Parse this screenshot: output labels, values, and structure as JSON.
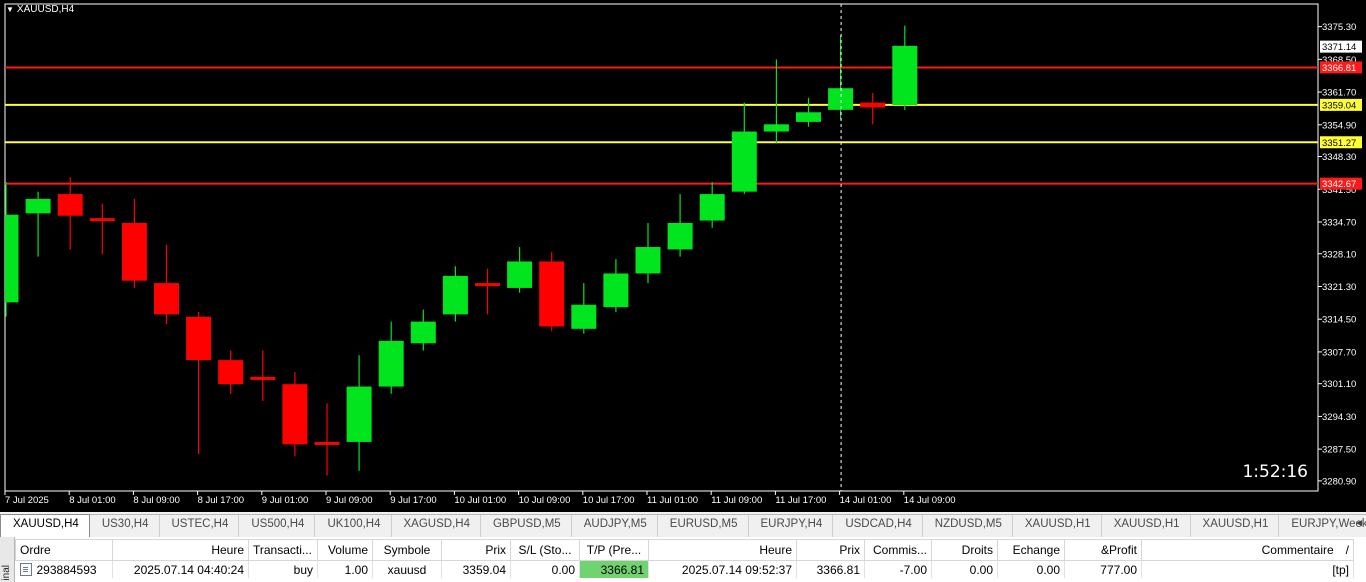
{
  "chart": {
    "symbol_title": "XAUUSD,H4",
    "countdown": "1:52:16",
    "colors": {
      "background": "#000000",
      "bull": "#00e51e",
      "bear": "#ff0000",
      "red_line": "#ff1a1a",
      "yellow_line": "#ffff33",
      "axis_text": "#ffffff"
    }
  },
  "chart_data": {
    "type": "candlestick",
    "title": "XAUUSD,H4",
    "ylim": [
      3278.8,
      3380.0
    ],
    "y_ticks": [
      3375.3,
      3368.5,
      3361.7,
      3354.9,
      3348.3,
      3341.5,
      3334.7,
      3328.1,
      3321.3,
      3314.5,
      3307.7,
      3301.1,
      3294.3,
      3287.5,
      3280.9
    ],
    "y_tick_labels": [
      "3375.30",
      "3368.50",
      "3361.70",
      "3354.90",
      "3348.30",
      "3341.50",
      "3334.70",
      "3328.10",
      "3321.30",
      "3314.50",
      "3307.70",
      "3301.10",
      "3294.30",
      "3287.50",
      "3280.90"
    ],
    "x_tick_labels": [
      "7 Jul 2025",
      "8 Jul 01:00",
      "8 Jul 09:00",
      "8 Jul 17:00",
      "9 Jul 01:00",
      "9 Jul 09:00",
      "9 Jul 17:00",
      "10 Jul 01:00",
      "10 Jul 09:00",
      "10 Jul 17:00",
      "11 Jul 01:00",
      "11 Jul 09:00",
      "11 Jul 17:00",
      "14 Jul 01:00",
      "14 Jul 09:00"
    ],
    "candles": [
      {
        "o": 3318.0,
        "h": 3343.0,
        "l": 3315.0,
        "c": 3336.2
      },
      {
        "o": 3336.5,
        "h": 3341.0,
        "l": 3327.5,
        "c": 3339.5
      },
      {
        "o": 3340.5,
        "h": 3344.0,
        "l": 3329.0,
        "c": 3336.0
      },
      {
        "o": 3335.5,
        "h": 3338.5,
        "l": 3328.0,
        "c": 3335.0
      },
      {
        "o": 3334.5,
        "h": 3339.5,
        "l": 3321.0,
        "c": 3322.5
      },
      {
        "o": 3322.0,
        "h": 3330.0,
        "l": 3313.5,
        "c": 3315.5
      },
      {
        "o": 3315.0,
        "h": 3316.0,
        "l": 3286.5,
        "c": 3306.0
      },
      {
        "o": 3306.0,
        "h": 3308.0,
        "l": 3299.0,
        "c": 3301.0
      },
      {
        "o": 3302.5,
        "h": 3308.0,
        "l": 3297.5,
        "c": 3302.0
      },
      {
        "o": 3301.0,
        "h": 3303.5,
        "l": 3286.0,
        "c": 3288.5
      },
      {
        "o": 3289.0,
        "h": 3297.0,
        "l": 3282.0,
        "c": 3288.5
      },
      {
        "o": 3289.0,
        "h": 3307.0,
        "l": 3283.0,
        "c": 3300.5
      },
      {
        "o": 3300.5,
        "h": 3314.0,
        "l": 3299.0,
        "c": 3310.0
      },
      {
        "o": 3309.5,
        "h": 3316.5,
        "l": 3308.0,
        "c": 3314.0
      },
      {
        "o": 3315.5,
        "h": 3325.5,
        "l": 3314.0,
        "c": 3323.5
      },
      {
        "o": 3322.0,
        "h": 3325.0,
        "l": 3315.5,
        "c": 3321.5
      },
      {
        "o": 3321.0,
        "h": 3329.5,
        "l": 3320.0,
        "c": 3326.5
      },
      {
        "o": 3326.5,
        "h": 3328.5,
        "l": 3312.0,
        "c": 3313.0
      },
      {
        "o": 3312.5,
        "h": 3322.0,
        "l": 3311.5,
        "c": 3317.5
      },
      {
        "o": 3317.0,
        "h": 3327.0,
        "l": 3316.0,
        "c": 3324.0
      },
      {
        "o": 3324.0,
        "h": 3334.5,
        "l": 3322.0,
        "c": 3329.5
      },
      {
        "o": 3329.0,
        "h": 3340.5,
        "l": 3327.5,
        "c": 3334.5
      },
      {
        "o": 3335.0,
        "h": 3343.0,
        "l": 3333.5,
        "c": 3340.5
      },
      {
        "o": 3341.0,
        "h": 3359.5,
        "l": 3340.5,
        "c": 3353.5
      },
      {
        "o": 3353.5,
        "h": 3368.5,
        "l": 3351.0,
        "c": 3355.0
      },
      {
        "o": 3355.5,
        "h": 3360.5,
        "l": 3354.5,
        "c": 3357.5
      },
      {
        "o": 3358.0,
        "h": 3373.5,
        "l": 3356.0,
        "c": 3362.5
      },
      {
        "o": 3359.5,
        "h": 3361.5,
        "l": 3355.0,
        "c": 3358.5
      },
      {
        "o": 3359.0,
        "h": 3375.5,
        "l": 3358.0,
        "c": 3371.3
      }
    ],
    "horizontal_lines": [
      {
        "price": 3366.81,
        "label": "3366.81",
        "color": "#ff1a1a"
      },
      {
        "price": 3359.04,
        "label": "3359.04",
        "color": "#ffff33"
      },
      {
        "price": 3351.27,
        "label": "3351.27",
        "color": "#ffff33"
      },
      {
        "price": 3342.67,
        "label": "3342.67",
        "color": "#ff1a1a"
      }
    ],
    "current_price_label": "3371.14",
    "current_price": 3371.14,
    "crosshair_x_label": "14 Jul 01:00"
  },
  "tabs": [
    {
      "label": "XAUUSD,H4",
      "active": true
    },
    {
      "label": "US30,H4"
    },
    {
      "label": "USTEC,H4"
    },
    {
      "label": "US500,H4"
    },
    {
      "label": "UK100,H4"
    },
    {
      "label": "XAGUSD,H4"
    },
    {
      "label": "GBPUSD,M5"
    },
    {
      "label": "AUDJPY,M5"
    },
    {
      "label": "EURUSD,M5"
    },
    {
      "label": "EURJPY,H4"
    },
    {
      "label": "USDCAD,H4"
    },
    {
      "label": "NZDUSD,M5"
    },
    {
      "label": "XAUUSD,H1"
    },
    {
      "label": "XAUUSD,H1"
    },
    {
      "label": "XAUUSD,H1"
    },
    {
      "label": "EURJPY,Weekly"
    }
  ],
  "tab_scroll_glyph": "◄",
  "terminal": {
    "side_label": "inal",
    "columns": [
      "Ordre",
      "Heure",
      "Transacti...",
      "Volume",
      "Symbole",
      "Prix",
      "S/L (Sto...",
      "T/P (Pre...",
      "Heure",
      "Prix",
      "Commis...",
      "Droits",
      "Echange",
      "&Profit",
      "Commentaire"
    ],
    "sort_glyph": "/",
    "rows": [
      {
        "order": "293884593",
        "open_time": "2025.07.14 04:40:24",
        "type": "buy",
        "volume": "1.00",
        "symbol": "xauusd",
        "price": "3359.04",
        "sl": "0.00",
        "tp": "3366.81",
        "time": "2025.07.14 09:52:37",
        "cur_price": "3366.81",
        "commission": "-7.00",
        "swap_rights": "0.00",
        "exchange": "0.00",
        "profit": "777.00",
        "comment": "[tp]"
      }
    ]
  }
}
